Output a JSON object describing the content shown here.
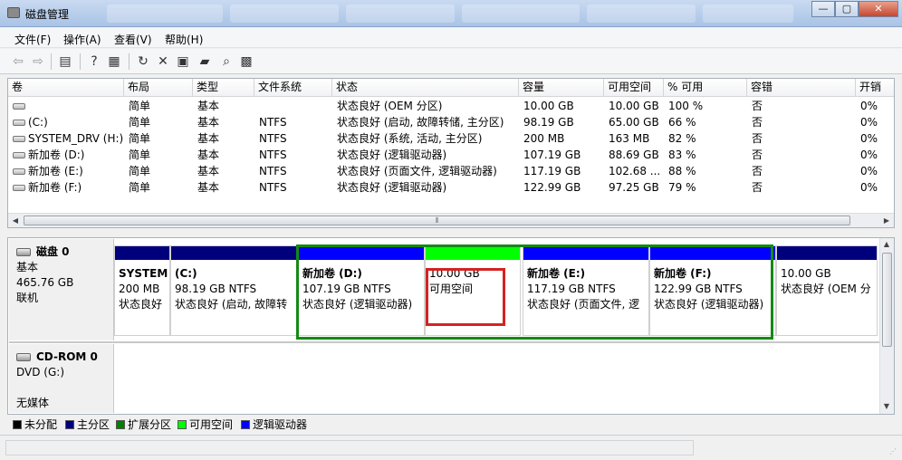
{
  "window": {
    "title": "磁盘管理",
    "controls": {
      "minimize": "—",
      "maximize": "▢",
      "close": "✕"
    }
  },
  "menu": [
    "文件(F)",
    "操作(A)",
    "查看(V)",
    "帮助(H)"
  ],
  "volume_list": {
    "columns": [
      "卷",
      "布局",
      "类型",
      "文件系统",
      "状态",
      "容量",
      "可用空间",
      "% 可用",
      "容错",
      "开销"
    ],
    "rows": [
      [
        "",
        "简单",
        "基本",
        "",
        "状态良好 (OEM 分区)",
        "10.00 GB",
        "10.00 GB",
        "100 %",
        "否",
        "0%"
      ],
      [
        "(C:)",
        "简单",
        "基本",
        "NTFS",
        "状态良好 (启动, 故障转储, 主分区)",
        "98.19 GB",
        "65.00 GB",
        "66 %",
        "否",
        "0%"
      ],
      [
        "SYSTEM_DRV (H:)",
        "简单",
        "基本",
        "NTFS",
        "状态良好 (系统, 活动, 主分区)",
        "200 MB",
        "163 MB",
        "82 %",
        "否",
        "0%"
      ],
      [
        "新加卷 (D:)",
        "简单",
        "基本",
        "NTFS",
        "状态良好 (逻辑驱动器)",
        "107.19 GB",
        "88.69 GB",
        "83 %",
        "否",
        "0%"
      ],
      [
        "新加卷 (E:)",
        "简单",
        "基本",
        "NTFS",
        "状态良好 (页面文件, 逻辑驱动器)",
        "117.19 GB",
        "102.68 ...",
        "88 %",
        "否",
        "0%"
      ],
      [
        "新加卷 (F:)",
        "简单",
        "基本",
        "NTFS",
        "状态良好 (逻辑驱动器)",
        "122.99 GB",
        "97.25 GB",
        "79 %",
        "否",
        "0%"
      ]
    ]
  },
  "disk0": {
    "name": "磁盘 0",
    "type": "基本",
    "size": "465.76 GB",
    "state": "联机",
    "partitions": [
      {
        "title": "SYSTEM",
        "size": "200 MB",
        "status": "状态良好",
        "bar_color": "#00007c"
      },
      {
        "title": "(C:)",
        "size": "98.19 GB NTFS",
        "status": "状态良好 (启动, 故障转",
        "bar_color": "#00007c"
      },
      {
        "title": "新加卷  (D:)",
        "size": "107.19 GB NTFS",
        "status": "状态良好 (逻辑驱动器)",
        "bar_color": "#0000ff"
      },
      {
        "title": "",
        "size": "10.00 GB",
        "status": "可用空间",
        "bar_color": "#00ff00"
      },
      {
        "title": "新加卷  (E:)",
        "size": "117.19 GB NTFS",
        "status": "状态良好 (页面文件, 逻",
        "bar_color": "#0000ff"
      },
      {
        "title": "新加卷  (F:)",
        "size": "122.99 GB NTFS",
        "status": "状态良好 (逻辑驱动器)",
        "bar_color": "#0000ff"
      },
      {
        "title": "",
        "size": "10.00 GB",
        "status": "状态良好 (OEM 分",
        "bar_color": "#00007c"
      }
    ]
  },
  "cdrom0": {
    "name": "CD-ROM 0",
    "drive": "DVD (G:)",
    "media": "无媒体"
  },
  "legend": [
    {
      "label": "未分配",
      "color": "#000000"
    },
    {
      "label": "主分区",
      "color": "#00007c"
    },
    {
      "label": "扩展分区",
      "color": "#008000"
    },
    {
      "label": "可用空间",
      "color": "#00ff00"
    },
    {
      "label": "逻辑驱动器",
      "color": "#0000ff"
    }
  ]
}
